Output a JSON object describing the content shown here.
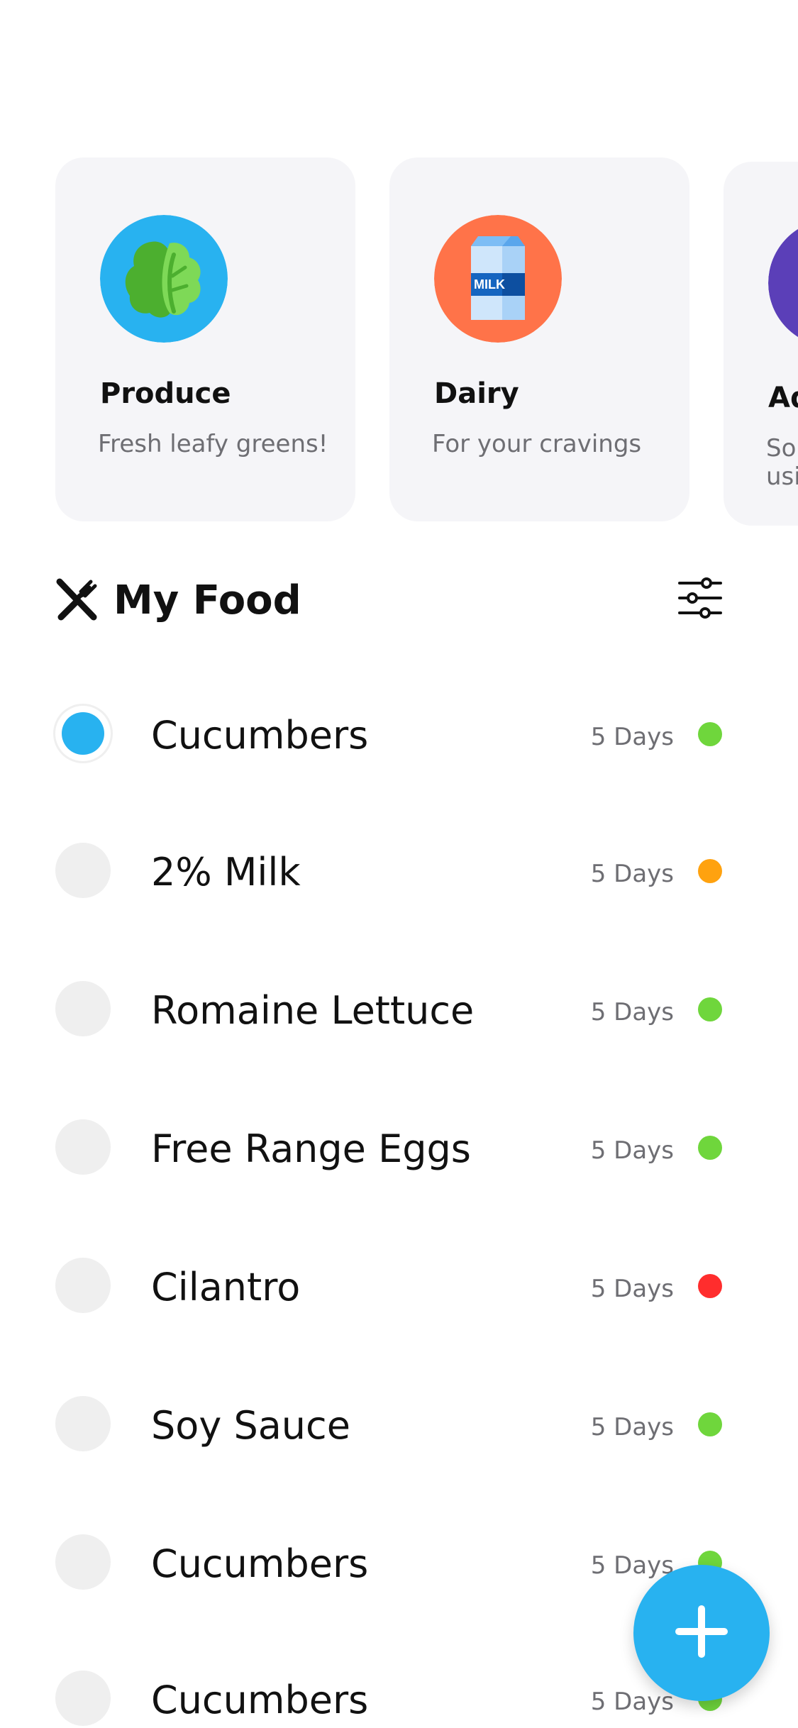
{
  "categories": [
    {
      "title": "Produce",
      "subtitle": "Fresh leafy greens!",
      "icon": "lettuce-icon",
      "color": "#28b2f0"
    },
    {
      "title": "Dairy",
      "subtitle": "For your cravings",
      "icon": "milk-carton-icon",
      "color": "#ff7349"
    },
    {
      "title": "Ad",
      "subtitle": "So usi",
      "icon": "category-icon",
      "color": "#5b3fb8"
    }
  ],
  "section": {
    "title": "My Food",
    "icon": "utensils-icon",
    "filter_icon": "sliders-icon"
  },
  "status_colors": {
    "green": "#6fd63c",
    "orange": "#ffa20f",
    "red": "#ff2d2d"
  },
  "foods": [
    {
      "name": "Cucumbers",
      "days": "5 Days",
      "status": "green",
      "checked": true
    },
    {
      "name": "2% Milk",
      "days": "5 Days",
      "status": "orange",
      "checked": false
    },
    {
      "name": "Romaine Lettuce",
      "days": "5 Days",
      "status": "green",
      "checked": false
    },
    {
      "name": "Free Range Eggs",
      "days": "5 Days",
      "status": "green",
      "checked": false
    },
    {
      "name": "Cilantro",
      "days": "5 Days",
      "status": "red",
      "checked": false
    },
    {
      "name": "Soy Sauce",
      "days": "5 Days",
      "status": "green",
      "checked": false
    },
    {
      "name": "Cucumbers",
      "days": "5 Days",
      "status": "green",
      "checked": false
    },
    {
      "name": "Cucumbers",
      "days": "5 Days",
      "status": "green",
      "checked": false
    }
  ],
  "fab": {
    "icon": "plus-icon"
  }
}
